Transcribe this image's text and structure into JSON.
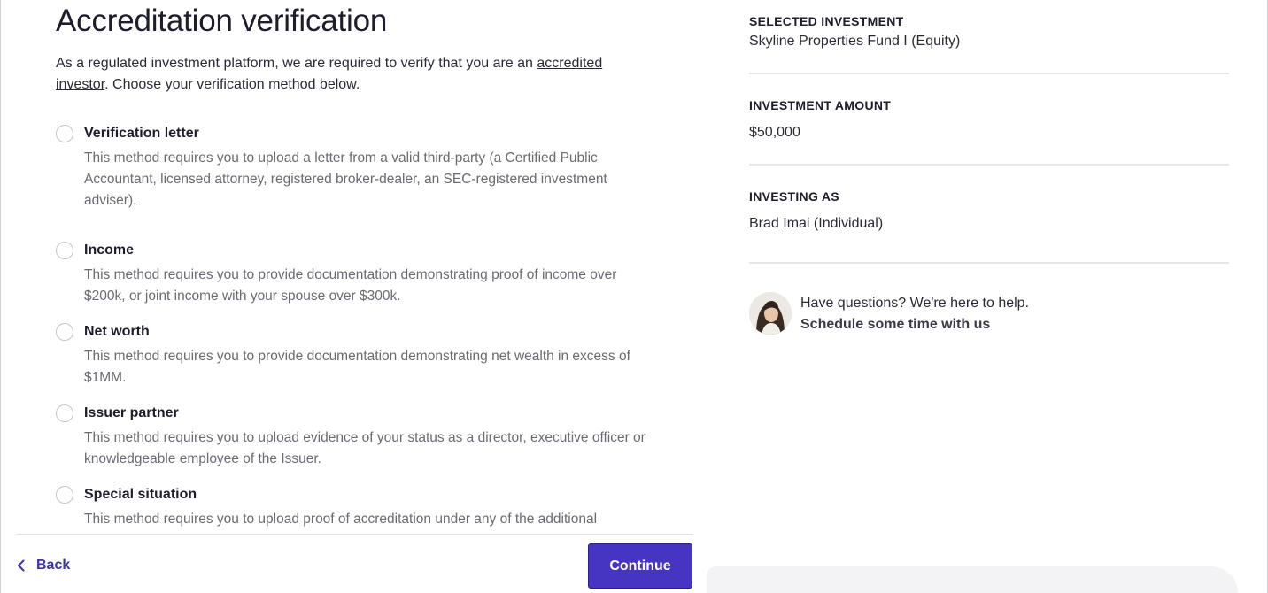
{
  "page": {
    "title": "Accreditation verification",
    "intro_prefix": "As a regulated investment platform, we are required to verify that you are an ",
    "intro_link": "accredited investor",
    "intro_suffix": ". Choose your verification method below."
  },
  "options": [
    {
      "title": "Verification letter",
      "description": "This method requires you to upload a letter from a valid third-party (a Certified Public Accountant, licensed attorney, registered broker-dealer, an SEC-registered investment adviser).",
      "selected": false
    },
    {
      "title": "Income",
      "description": "This method requires you to provide documentation demonstrating proof of income over $200k, or joint income with your spouse over $300k.",
      "selected": false
    },
    {
      "title": "Net worth",
      "description": "This method requires you to provide documentation demonstrating net wealth in excess of $1MM.",
      "selected": false
    },
    {
      "title": "Issuer partner",
      "description": "This method requires you to upload evidence of your status as a director, executive officer or knowledgeable employee of the Issuer.",
      "selected": false
    },
    {
      "title": "Special situation",
      "description": "This method requires you to upload proof of accreditation under any of the additional",
      "selected": false
    }
  ],
  "footer": {
    "back_label": "Back",
    "continue_label": "Continue"
  },
  "summary": {
    "selected_investment_label": "SELECTED INVESTMENT",
    "selected_investment_value": "Skyline Properties Fund I (Equity)",
    "investment_amount_label": "INVESTMENT AMOUNT",
    "investment_amount_value": "$50,000",
    "investing_as_label": "INVESTING AS",
    "investing_as_value": "Brad Imai (Individual)"
  },
  "help": {
    "text": "Have questions? We're here to help.",
    "link": "Schedule some time with us"
  },
  "colors": {
    "primary": "#4535c1",
    "link": "#3d34a8",
    "muted_text": "#6a6a74"
  }
}
